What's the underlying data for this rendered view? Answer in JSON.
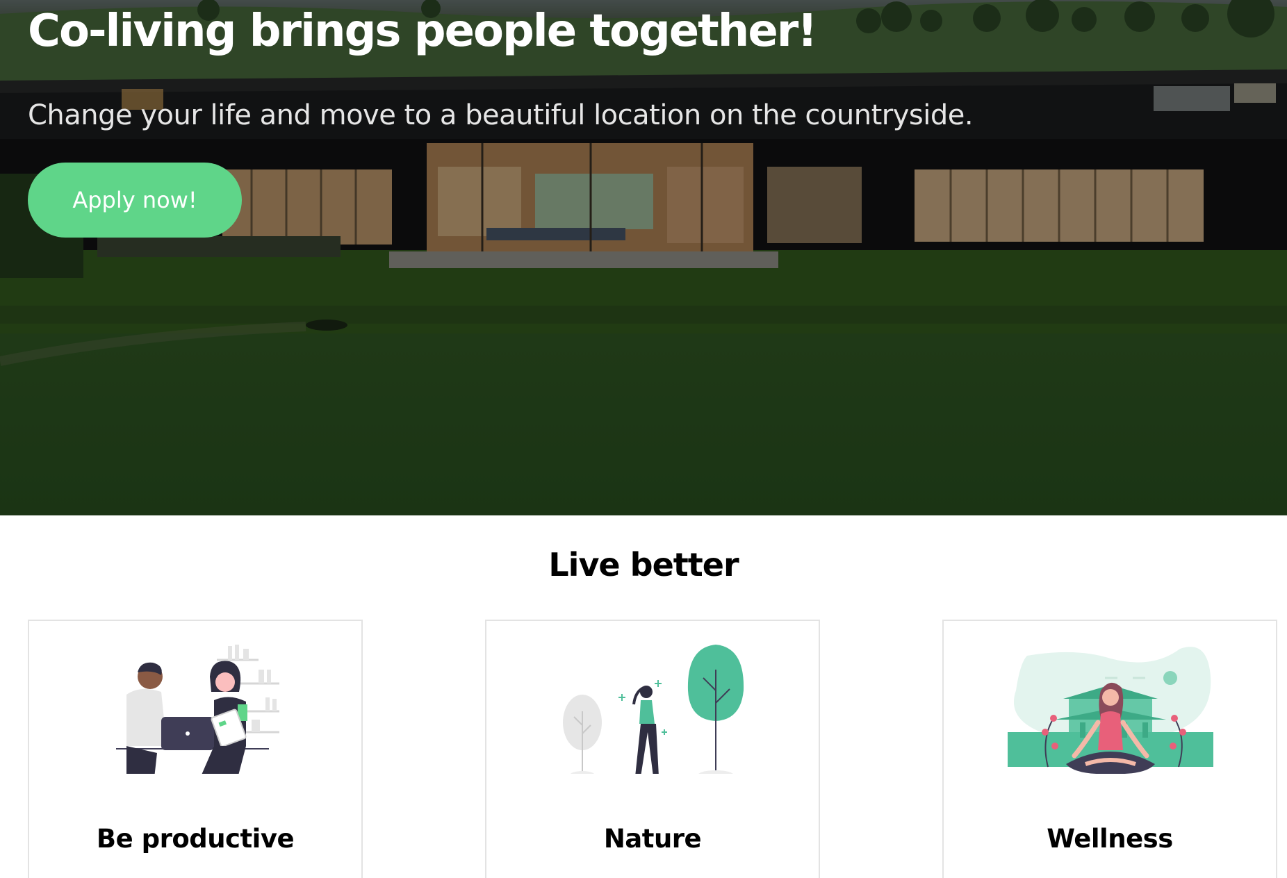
{
  "hero": {
    "title": "Co-living brings people together!",
    "subtitle": "Change your life and move to a beautiful location on the countryside.",
    "apply_label": "Apply now!"
  },
  "section": {
    "title": "Live better",
    "cards": [
      {
        "title": "Be productive",
        "illustration": "coworking-illustration"
      },
      {
        "title": "Nature",
        "illustration": "nature-walk-illustration"
      },
      {
        "title": "Wellness",
        "illustration": "meditation-illustration"
      }
    ]
  },
  "colors": {
    "accent": "#5fd589",
    "illustration_green": "#4fbf9a",
    "illustration_pink": "#e8607a",
    "illustration_dark": "#2f2e41"
  }
}
